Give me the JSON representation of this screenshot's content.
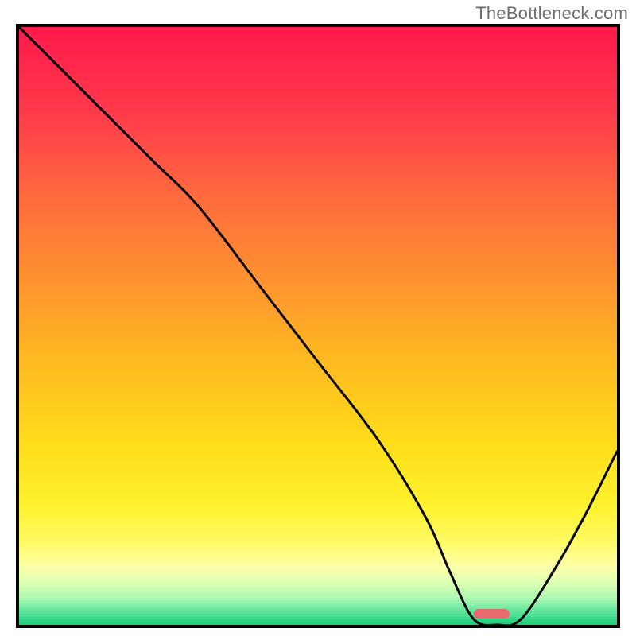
{
  "watermark": "TheBottleneck.com",
  "chart_data": {
    "type": "line",
    "title": "",
    "xlabel": "",
    "ylabel": "",
    "xlim": [
      0,
      100
    ],
    "ylim": [
      0,
      100
    ],
    "series": [
      {
        "name": "curve",
        "x": [
          0,
          10,
          22,
          30,
          40,
          50,
          60,
          68,
          72,
          76,
          80,
          84,
          90,
          95,
          100
        ],
        "values": [
          100,
          90,
          78,
          70,
          57,
          44,
          31,
          18,
          9,
          1,
          0,
          1,
          10,
          19,
          29
        ]
      }
    ],
    "annotations": [
      {
        "name": "marker-bar",
        "x_start": 76,
        "x_end": 82,
        "y": 0
      }
    ],
    "background_gradient": {
      "stops": [
        {
          "pos": 0.0,
          "color": "#ff1a4b"
        },
        {
          "pos": 0.14,
          "color": "#ff3a4a"
        },
        {
          "pos": 0.28,
          "color": "#ff6a3e"
        },
        {
          "pos": 0.42,
          "color": "#ff9230"
        },
        {
          "pos": 0.56,
          "color": "#ffbb20"
        },
        {
          "pos": 0.7,
          "color": "#ffde1a"
        },
        {
          "pos": 0.8,
          "color": "#fff22e"
        },
        {
          "pos": 0.86,
          "color": "#fffb66"
        },
        {
          "pos": 0.9,
          "color": "#fdffa8"
        },
        {
          "pos": 0.93,
          "color": "#d9ffb4"
        },
        {
          "pos": 0.955,
          "color": "#a6f7b0"
        },
        {
          "pos": 0.975,
          "color": "#60e69a"
        },
        {
          "pos": 1.0,
          "color": "#14c877"
        }
      ]
    },
    "marker_color": "#e86a6d"
  }
}
